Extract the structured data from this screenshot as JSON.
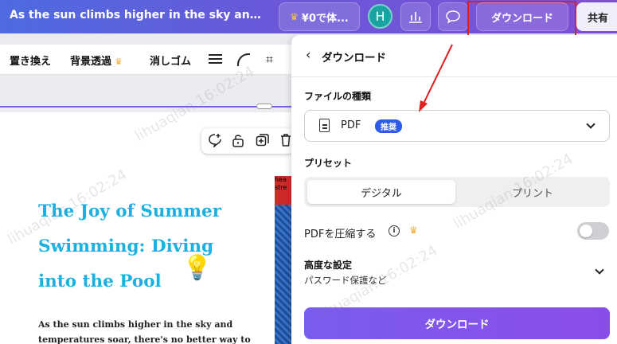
{
  "header": {
    "doc_title": "As the sun climbs higher in the sky and temp...",
    "trial_label": "¥0で体...",
    "avatar_letter": "H",
    "download_label": "ダウンロード",
    "share_label": "共有"
  },
  "toolbar": {
    "replace": "置き換え",
    "bg_remove": "背景透過",
    "eraser": "消しゴム"
  },
  "page": {
    "heading": "The Joy of Summer Swimming: Diving into the Pool",
    "body": "As the sun climbs higher in the sky and temperatures soar, there's no better way to",
    "image_strip_text": "hea stre"
  },
  "panel": {
    "title": "ダウンロード",
    "file_type_label": "ファイルの種類",
    "file_type_value": "PDF",
    "file_type_badge": "推奨",
    "preset_label": "プリセット",
    "preset_options": [
      "デジタル",
      "プリント"
    ],
    "compress_label": "PDFを圧縮する",
    "compress_enabled": false,
    "advanced_title": "高度な設定",
    "advanced_subtitle": "パスワード保護など",
    "download_button": "ダウンロード"
  },
  "watermark": {
    "text": "lihuaqian 16:02:24"
  },
  "colors": {
    "accent": "#7b5cf0",
    "heading": "#1ab0e0",
    "badge": "#2f5be8",
    "annotation": "#e02020"
  }
}
